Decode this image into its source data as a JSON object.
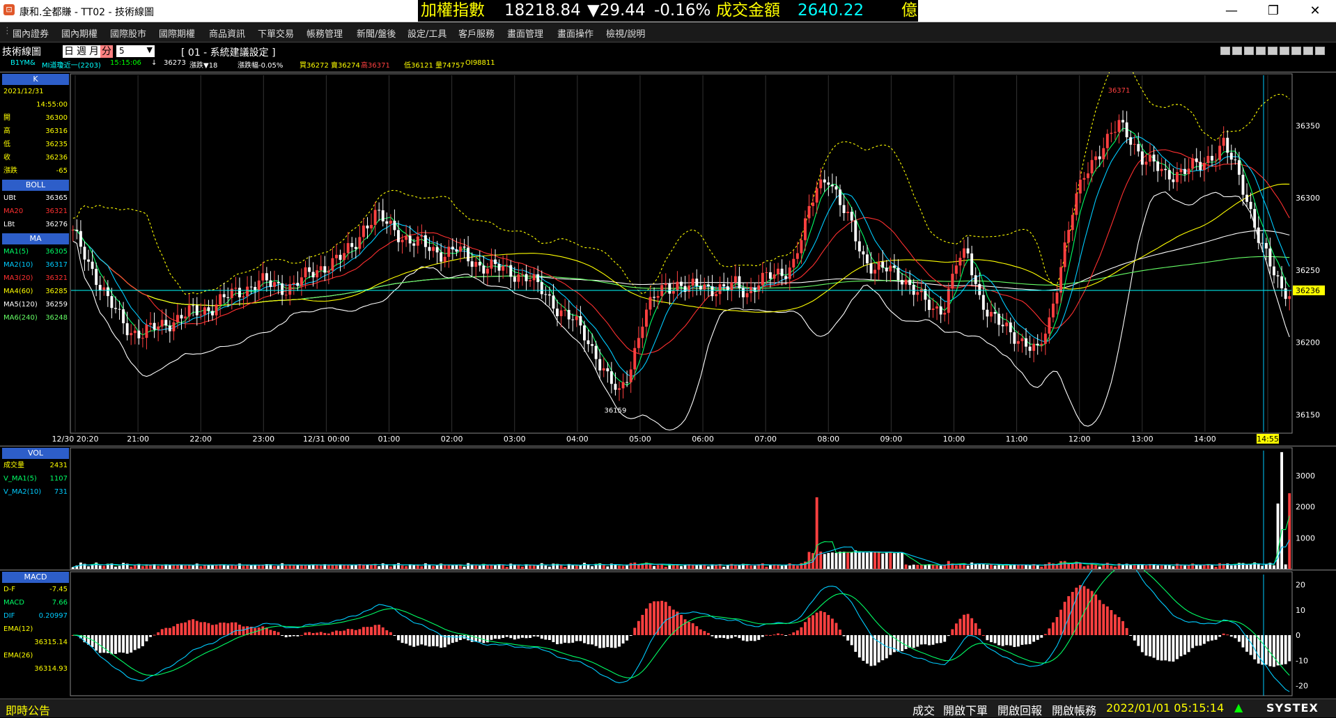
{
  "window": {
    "app_title": "康和.全都賺 - TT02 - 技術線圖",
    "icon_glyph": "⊡",
    "min_glyph": "—",
    "max_glyph": "❐",
    "close_glyph": "✕"
  },
  "ticker": {
    "name": "加權指數",
    "value": "18218.84",
    "change": "▼29.44",
    "change_pct": "-0.16%",
    "turnover_label": "成交金額",
    "turnover": "2640.22",
    "unit": "億",
    "colors": {
      "label": "#ffff00",
      "value": "#ffffff",
      "down": "#ffffff",
      "turnover_value": "#00ffff"
    }
  },
  "menu": [
    "國內證券",
    "國內期權",
    "國際股市",
    "國際期權",
    "商品資訊",
    "下單交易",
    "帳務管理",
    "新聞/盤後",
    "設定/工具",
    "客戶服務",
    "畫面管理",
    "畫面操作",
    "檢視/說明"
  ],
  "toolbar": {
    "title": "技術線圖",
    "periods": [
      "日",
      "週",
      "月",
      "分"
    ],
    "active_period": "分",
    "interval": "5",
    "setting_label": "[ 01 - 系統建議設定 ]"
  },
  "quote_line": [
    {
      "text": "B1YM&",
      "color": "#00ffff"
    },
    {
      "text": "MI道瓊近一(2203)",
      "color": "#00ffff"
    },
    {
      "text": "15:15:06",
      "color": "#00ff00"
    },
    {
      "text": "↓",
      "color": "#ffffff"
    },
    {
      "text": "36273",
      "color": "#ffffff"
    },
    {
      "text": "漲跌▼18",
      "color": "#ffffff"
    },
    {
      "text": "漲跌幅-0.05%",
      "color": "#ffffff"
    },
    {
      "text": "買36272",
      "color": "#ffff00"
    },
    {
      "text": "賣36274",
      "color": "#ffff00"
    },
    {
      "text": "高36371",
      "color": "#ff4040"
    },
    {
      "text": "低36121",
      "color": "#ffff00"
    },
    {
      "text": "量74757",
      "color": "#ffff00"
    },
    {
      "text": "OI98811",
      "color": "#ffff00"
    }
  ],
  "sidebar_k": {
    "header": "K",
    "date": "2021/12/31",
    "time": "14:55:00",
    "rows": [
      {
        "label": "開",
        "value": "36300"
      },
      {
        "label": "高",
        "value": "36316"
      },
      {
        "label": "低",
        "value": "36235"
      },
      {
        "label": "收",
        "value": "36236"
      },
      {
        "label": "漲跌",
        "value": "-65"
      }
    ]
  },
  "sidebar_boll": {
    "header": "BOLL",
    "rows": [
      {
        "label": "UBt",
        "value": "36365",
        "color": "#ffffff"
      },
      {
        "label": "MA20",
        "value": "36321",
        "color": "#ff3030"
      },
      {
        "label": "LBt",
        "value": "36276",
        "color": "#ffffff"
      }
    ]
  },
  "sidebar_ma": {
    "header": "MA",
    "rows": [
      {
        "label": "MA1(5)",
        "value": "36305",
        "color": "#00ff66"
      },
      {
        "label": "MA2(10)",
        "value": "36317",
        "color": "#00ccff"
      },
      {
        "label": "MA3(20)",
        "value": "36321",
        "color": "#ff3030"
      },
      {
        "label": "MA4(60)",
        "value": "36285",
        "color": "#ffff00"
      },
      {
        "label": "MA5(120)",
        "value": "36259",
        "color": "#ffffff"
      },
      {
        "label": "MA6(240)",
        "value": "36248",
        "color": "#66ff66"
      }
    ]
  },
  "sidebar_vol": {
    "header": "VOL",
    "rows": [
      {
        "label": "成交量",
        "value": "2431",
        "color": "#ffff00"
      },
      {
        "label": "V_MA1(5)",
        "value": "1107",
        "color": "#00ff66"
      },
      {
        "label": "V_MA2(10)",
        "value": "731",
        "color": "#00ccff"
      }
    ]
  },
  "sidebar_macd": {
    "header": "MACD",
    "rows": [
      {
        "label": "D-F",
        "value": "-7.45",
        "color": "#ffff00"
      },
      {
        "label": "MACD",
        "value": "7.66",
        "color": "#00ff66"
      },
      {
        "label": "DIF",
        "value": "0.20997",
        "color": "#00ccff"
      },
      {
        "label": "EMA(12)",
        "value": "",
        "color": "#ffff00"
      },
      {
        "label": "",
        "value": "36315.14",
        "color": "#ffff00"
      },
      {
        "label": "EMA(26)",
        "value": "",
        "color": "#ffff00"
      },
      {
        "label": "",
        "value": "36314.93",
        "color": "#ffff00"
      }
    ]
  },
  "status": {
    "left": "即時公告",
    "items": [
      "成交",
      "開啟下單",
      "開啟回報",
      "開啟帳務"
    ],
    "datetime": "2022/01/01 05:15:14",
    "brand": "SYSTEX"
  },
  "chart_data": {
    "type": "candlestick",
    "symbol": "MI道瓊近一(2203)",
    "interval_minutes": 5,
    "price_ylim": [
      36140,
      36385
    ],
    "price_ticks": [
      36150,
      36200,
      36250,
      36300,
      36350
    ],
    "last_price": 36236,
    "high_annotation": 36371,
    "low_annotation": 36159,
    "time_labels": [
      "12/30 20:20",
      "21:00",
      "22:00",
      "23:00",
      "12/31 00:00",
      "01:00",
      "02:00",
      "03:00",
      "04:00",
      "05:00",
      "06:00",
      "07:00",
      "08:00",
      "09:00",
      "10:00",
      "11:00",
      "12:00",
      "13:00",
      "14:00",
      "14:55"
    ],
    "price_path": [
      36275,
      36262,
      36245,
      36228,
      36218,
      36208,
      36205,
      36210,
      36214,
      36216,
      36220,
      36222,
      36225,
      36230,
      36234,
      36238,
      36242,
      36240,
      36238,
      36240,
      36245,
      36250,
      36255,
      36258,
      36265,
      36280,
      36288,
      36282,
      36276,
      36270,
      36268,
      36264,
      36262,
      36264,
      36258,
      36254,
      36252,
      36250,
      36248,
      36246,
      36238,
      36230,
      36222,
      36215,
      36205,
      36192,
      36175,
      36163,
      36185,
      36215,
      36230,
      36240,
      36240,
      36236,
      36240,
      36238,
      36236,
      36240,
      36235,
      36242,
      36245,
      36248,
      36256,
      36280,
      36308,
      36316,
      36295,
      36280,
      36260,
      36250,
      36250,
      36248,
      36240,
      36230,
      36222,
      36226,
      36255,
      36260,
      36232,
      36218,
      36210,
      36205,
      36200,
      36192,
      36214,
      36255,
      36290,
      36315,
      36330,
      36340,
      36350,
      36342,
      36328,
      36322,
      36316,
      36318,
      36320,
      36322,
      36330,
      36338,
      36320,
      36300,
      36274,
      36252,
      36236
    ],
    "volume_ylim": [
      0,
      3800
    ],
    "volume_ticks": [
      1000,
      2000,
      3000
    ],
    "volume_last": 2431,
    "volume_peak": 3750,
    "macd_ylim": [
      -24,
      24
    ],
    "macd_ticks": [
      20,
      10,
      0,
      -10,
      -20
    ],
    "macd_last": {
      "D-F": -7.45,
      "MACD": 7.66,
      "DIF": 0.20997
    }
  }
}
